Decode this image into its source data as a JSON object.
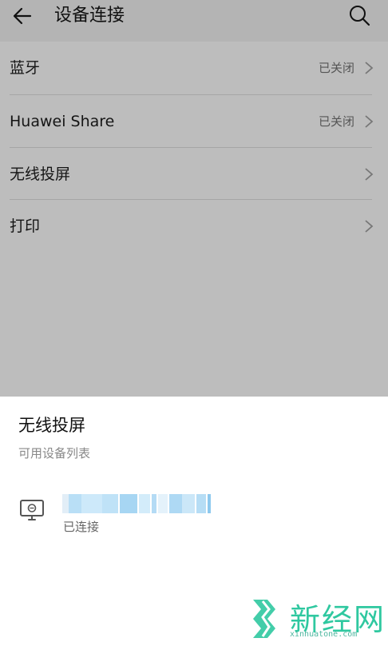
{
  "appbar": {
    "title": "设备连接",
    "back_icon": "back-arrow-icon",
    "search_icon": "search-icon"
  },
  "settings": {
    "items": [
      {
        "label": "蓝牙",
        "status": "已关闭",
        "icon": "chevron-right-icon"
      },
      {
        "label": "Huawei Share",
        "status": "已关闭",
        "icon": "chevron-right-icon"
      },
      {
        "label": "无线投屏",
        "status": "",
        "icon": "chevron-right-icon"
      },
      {
        "label": "打印",
        "status": "",
        "icon": "chevron-right-icon"
      }
    ]
  },
  "sheet": {
    "title": "无线投屏",
    "subtitle": "可用设备列表",
    "devices": [
      {
        "icon": "monitor-icon",
        "status": "已连接"
      }
    ]
  },
  "watermark": {
    "text": "新经网",
    "url": "xinhuatone.com"
  },
  "colors": {
    "overlay_bg": "#bdbdbd",
    "sheet_bg": "#ffffff",
    "watermark": "#2fc8a0"
  }
}
